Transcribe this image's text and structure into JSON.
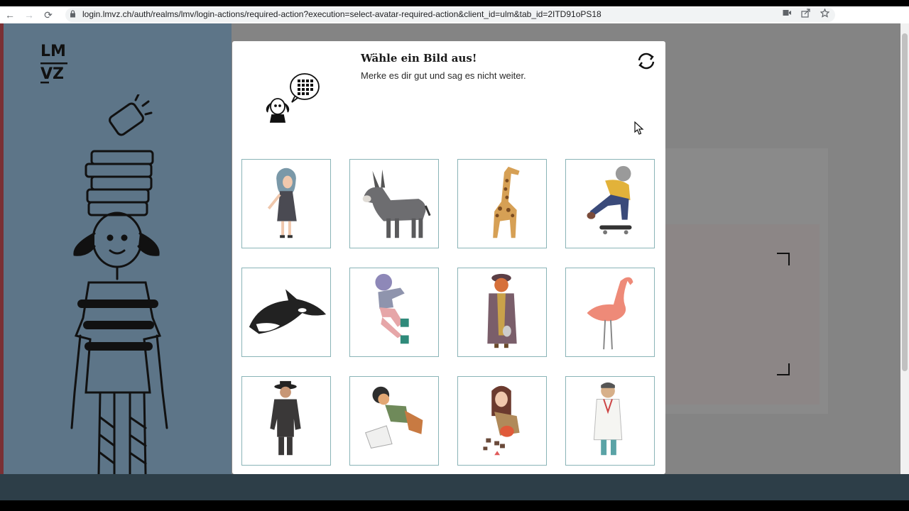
{
  "browser": {
    "url": "login.lmvz.ch/auth/realms/lmv/login-actions/required-action?execution=select-avatar-required-action&client_id=ulm&tab_id=2ITD91oPS18",
    "back_glyph": "←",
    "forward_glyph": "→",
    "reload_glyph": "⟳"
  },
  "brand": {
    "logo_line1": "LM",
    "logo_line2": "VZ"
  },
  "modal": {
    "title": "Wähle ein Bild aus!",
    "subtitle": "Merke es dir gut und sag es nicht weiter.",
    "avatars": [
      {
        "name": "girl"
      },
      {
        "name": "donkey"
      },
      {
        "name": "giraffe"
      },
      {
        "name": "skateboarder"
      },
      {
        "name": "orca"
      },
      {
        "name": "roller-skater"
      },
      {
        "name": "woman-in-coat"
      },
      {
        "name": "flamingo"
      },
      {
        "name": "man-in-hat"
      },
      {
        "name": "boy-crawling"
      },
      {
        "name": "girl-with-stones"
      },
      {
        "name": "doctor"
      }
    ]
  },
  "colors": {
    "modal_bg": "#ffffff",
    "tile_border": "#8ab4b7",
    "left_panel": "#5d7588",
    "overlay": "#848484"
  }
}
